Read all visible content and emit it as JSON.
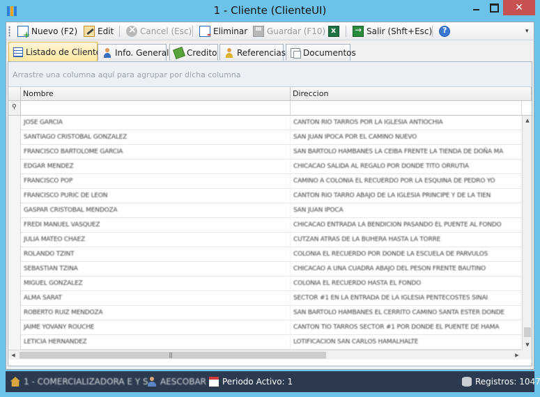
{
  "window": {
    "title": "1 - Cliente (ClienteUI)",
    "close_label": "✕"
  },
  "toolbar": {
    "nuevo": "Nuevo (F2)",
    "edit": "Edit",
    "cancel": "Cancel (Esc)",
    "eliminar": "Eliminar",
    "guardar": "Guardar (F10)",
    "salir": "Salir (Shft+Esc)",
    "overflow": "▾"
  },
  "tabs": [
    {
      "label": "Listado de Clientes",
      "active": true
    },
    {
      "label": "Info. General"
    },
    {
      "label": "Credito"
    },
    {
      "label": "Referencias"
    },
    {
      "label": "Documentos"
    }
  ],
  "grid": {
    "group_hint": "Arrastre una columna aquí para agrupar por dicha columna",
    "columns": [
      "Nombre",
      "Direccion"
    ],
    "filter_icon": "⚲",
    "rows": [
      {
        "nombre": "JOSE GARCIA",
        "direccion": "CANTON RIO TARROS POR LA IGLESIA ANTIOCHIA"
      },
      {
        "nombre": "SANTIAGO CRISTOBAL GONZALEZ",
        "direccion": "SAN JUAN IPOCA POR EL CAMINO NUEVO"
      },
      {
        "nombre": "FRANCISCO BARTOLOME GARCIA",
        "direccion": "SAN BARTOLO HAMBANES LA CEIBA FRENTE LA TIENDA DE DOÑA MA"
      },
      {
        "nombre": "EDGAR MENDEZ",
        "direccion": "CHICACAO SALIDA AL REGALO POR DONDE TITO ORRUTIA"
      },
      {
        "nombre": "FRANCISCO POP",
        "direccion": "CAMINO A COLONIA EL RECUERDO POR LA ESQUINA DE PEDRO YO"
      },
      {
        "nombre": "FRANCISCO PURIC DE LEON",
        "direccion": "CANTON RIO TARRO ABAJO DE LA IGLESIA PRINCIPE Y DE LA TIEN"
      },
      {
        "nombre": "GASPAR CRISTOBAL MENDOZA",
        "direccion": "SAN JUAN IPOCA"
      },
      {
        "nombre": "FREDI MANUEL VASQUEZ",
        "direccion": "CHICACAO ENTRADA LA BENDICION PASANDO EL PUENTE AL FONDO"
      },
      {
        "nombre": "JULIA MATEO CHAEZ",
        "direccion": "CUTZAN ATRAS DE LA BUHERA HASTA LA TORRE"
      },
      {
        "nombre": "ROLANDO TZINT",
        "direccion": "COLONIA EL RECUERDO POR DONDE LA ESCUELA DE PARVULOS"
      },
      {
        "nombre": "SEBASTIAN TZINA",
        "direccion": "CHICACAO A UNA CUADRA ABAJO DEL PESON FRENTE BAUTINO"
      },
      {
        "nombre": "MIGUEL GONZALEZ",
        "direccion": "COLONIA EL RECUERDO HASTA EL FONDO"
      },
      {
        "nombre": "ALMA SARAT",
        "direccion": "SECTOR #1 EN LA ENTRADA DE LA IGLESIA PENTECOSTES SINAI"
      },
      {
        "nombre": "ROBERTO RUIZ MENDOZA",
        "direccion": "SAN BARTOLO HAMBANES EL CERRITO CAMINO SANTA ESTER DONDE"
      },
      {
        "nombre": "JAIME YOVANY ROUCHE",
        "direccion": "CANTON TIO TARROS SECTOR #1 POR DONDE EL PUENTE DE HAMA"
      },
      {
        "nombre": "LETICIA HERNANDEZ",
        "direccion": "LOTIFICACION SAN CARLOS HAMALHALTE"
      }
    ]
  },
  "statusbar": {
    "empresa": "1 - COMERCIALIZADORA E Y S",
    "usuario": "AESCOBAR",
    "periodo": "Periodo Activo: 1",
    "registros": "Registros: 1047"
  },
  "colors": {
    "window_frame": "#6dc2e9",
    "close_button": "#c75050",
    "active_tab": "#fde7a0",
    "statusbar": "#2b3a4e"
  }
}
